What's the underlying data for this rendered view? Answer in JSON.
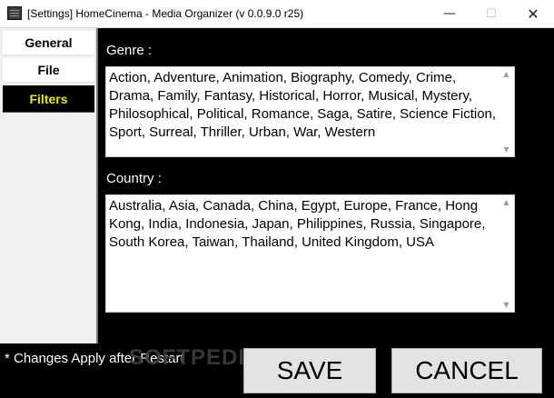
{
  "window": {
    "title": "[Settings] HomeCinema - Media Organizer (v 0.0.9.0 r25)",
    "min_glyph": "—",
    "max_glyph": "☐",
    "close_glyph": "✕"
  },
  "sidebar": {
    "items": [
      {
        "label": "General"
      },
      {
        "label": "File"
      },
      {
        "label": "Filters",
        "selected": true
      }
    ]
  },
  "filters": {
    "genre_label": "Genre :",
    "genre_value": "Action, Adventure, Animation, Biography, Comedy, Crime, Drama, Family, Fantasy, Historical, Horror, Musical, Mystery, Philosophical, Political, Romance, Saga, Satire, Science Fiction, Sport, Surreal, Thriller, Urban, War, Western",
    "country_label": "Country :",
    "country_value": "Australia, Asia, Canada, China, Egypt, Europe, France, Hong Kong, India, Indonesia, Japan, Philippines, Russia, Singapore, South Korea, Taiwan, Thailand, United Kingdom, USA"
  },
  "footer": {
    "note": "* Changes Apply after Restart",
    "watermark": "SOFTPEDIA",
    "save_label": "SAVE",
    "cancel_label": "CANCEL"
  },
  "colors": {
    "selected_tab_text": "#f4e600",
    "background": "#000000"
  }
}
